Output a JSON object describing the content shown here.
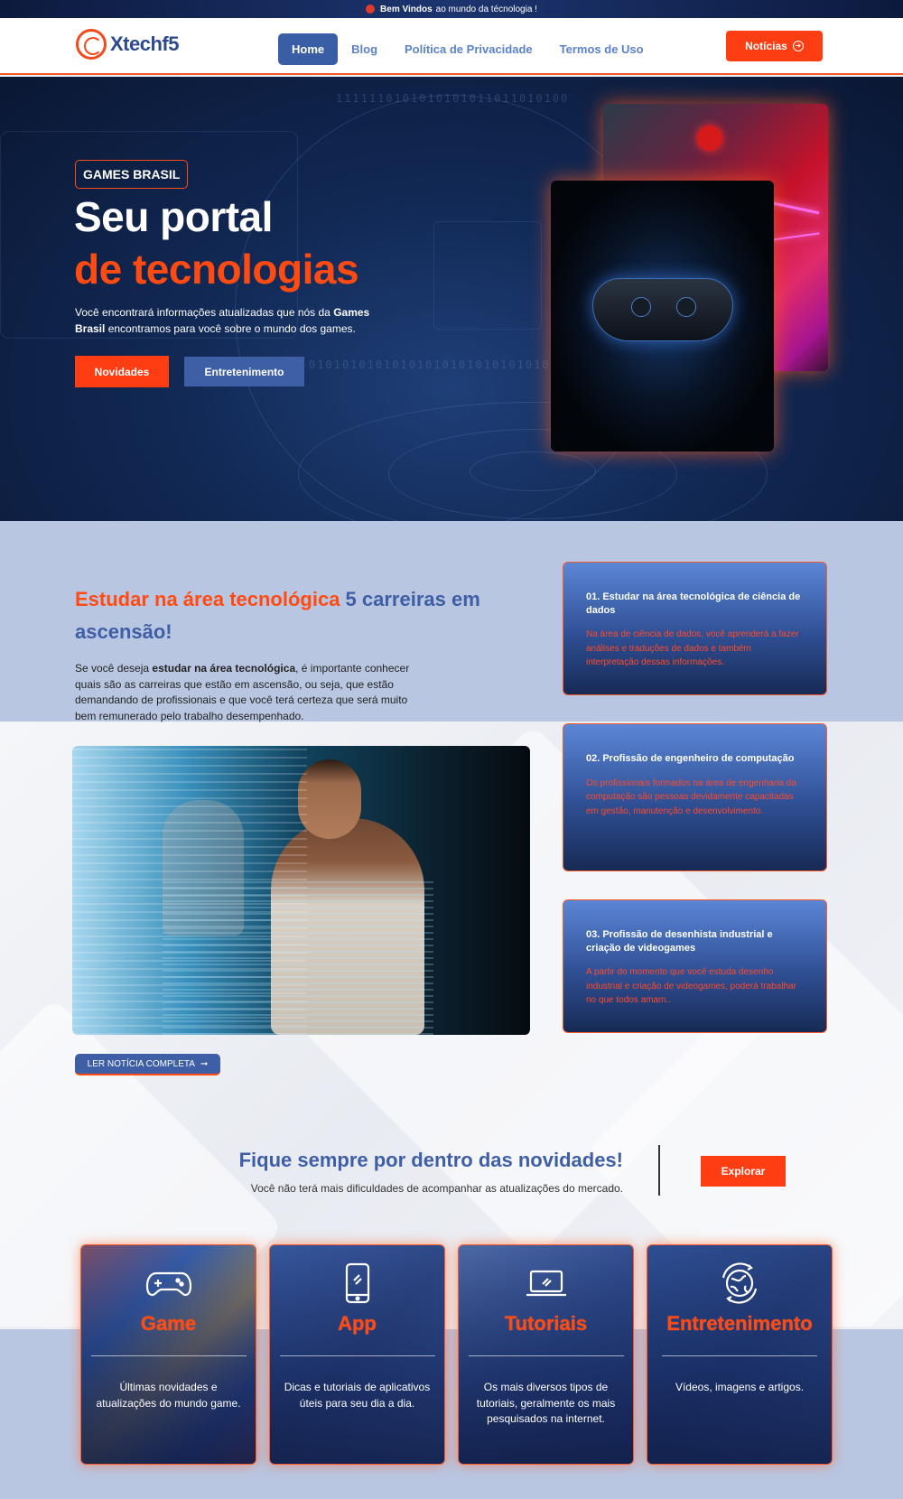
{
  "topbar": {
    "bold": "Bem Vindos",
    "text": "ao mundo da técnologia !"
  },
  "header": {
    "logo": "Xtechf5",
    "nav": [
      "Home",
      "Blog",
      "Política de Privacidade",
      "Termos de Uso"
    ],
    "news_button": "Notícias"
  },
  "hero": {
    "tag": "GAMES BRASIL",
    "title_line1": "Seu portal",
    "title_line2": "de tecnologias",
    "desc_before": "Você encontrará informações atualizadas que nós da ",
    "desc_bold": "Games Brasil",
    "desc_after": " encontramos para você sobre o mundo dos games.",
    "button_primary": "Novidades",
    "button_secondary": "Entretenimento",
    "binary_1": "1111110101010101011011010100",
    "binary_2": "0101010101010101010101010101010"
  },
  "section2": {
    "title_orange": "Estudar na área tecnológica",
    "title_blue": " 5 carreiras em ascensão!",
    "p_before": "Se você deseja ",
    "p_bold": "estudar na área tecnológica",
    "p_after": ", é importante conhecer quais são as carreiras que estão em ascensão, ou seja, que estão demandando de profissionais e que você terá certeza que será muito bem remunerado pelo trabalho desempenhado.",
    "read_button": "LER NOTÍCIA COMPLETA",
    "cards": [
      {
        "title": "01. Estudar na área tecnológica de ciência de dados",
        "text": "Na área de ciência de dados, você aprenderá a fazer análises e traduções de dados e também interpretação dessas informações."
      },
      {
        "title": "02. Profissão de engenheiro de computação",
        "text": "Os profissionais formados na área de engenharia da computação são pessoas devidamente capacitadas em gestão, manutenção e desenvolvimento."
      },
      {
        "title": "03. Profissão de desenhista industrial e criação de videogames",
        "text": "A partir do momento que você estuda desenho industrial e criação de videogames, poderá trabalhar no que todos amam.."
      }
    ]
  },
  "section3": {
    "title": "Fique sempre por dentro das novidades!",
    "subtitle": "Você não terá mais dificuldades de acompanhar as atualizações do mercado.",
    "explore_button": "Explorar"
  },
  "features": [
    {
      "title": "Game",
      "text": "Últimas novidades e atualizações do mundo game.",
      "icon": "gamepad-icon"
    },
    {
      "title": "App",
      "text": "Dicas e tutoriais de aplicativos úteis para seu dia a dia.",
      "icon": "smartphone-icon"
    },
    {
      "title": "Tutoriais",
      "text": "Os mais diversos tipos de tutoriais, geralmente os mais pesquisados na internet.",
      "icon": "laptop-icon"
    },
    {
      "title": "Entretenimento",
      "text": "Vídeos, imagens e artigos.",
      "icon": "globe-refresh-icon"
    }
  ],
  "colors": {
    "accent": "#ff3d12",
    "primary": "#3e5ea6",
    "hero_bg": "#0f2350",
    "section_bg": "#b9c6e1"
  }
}
